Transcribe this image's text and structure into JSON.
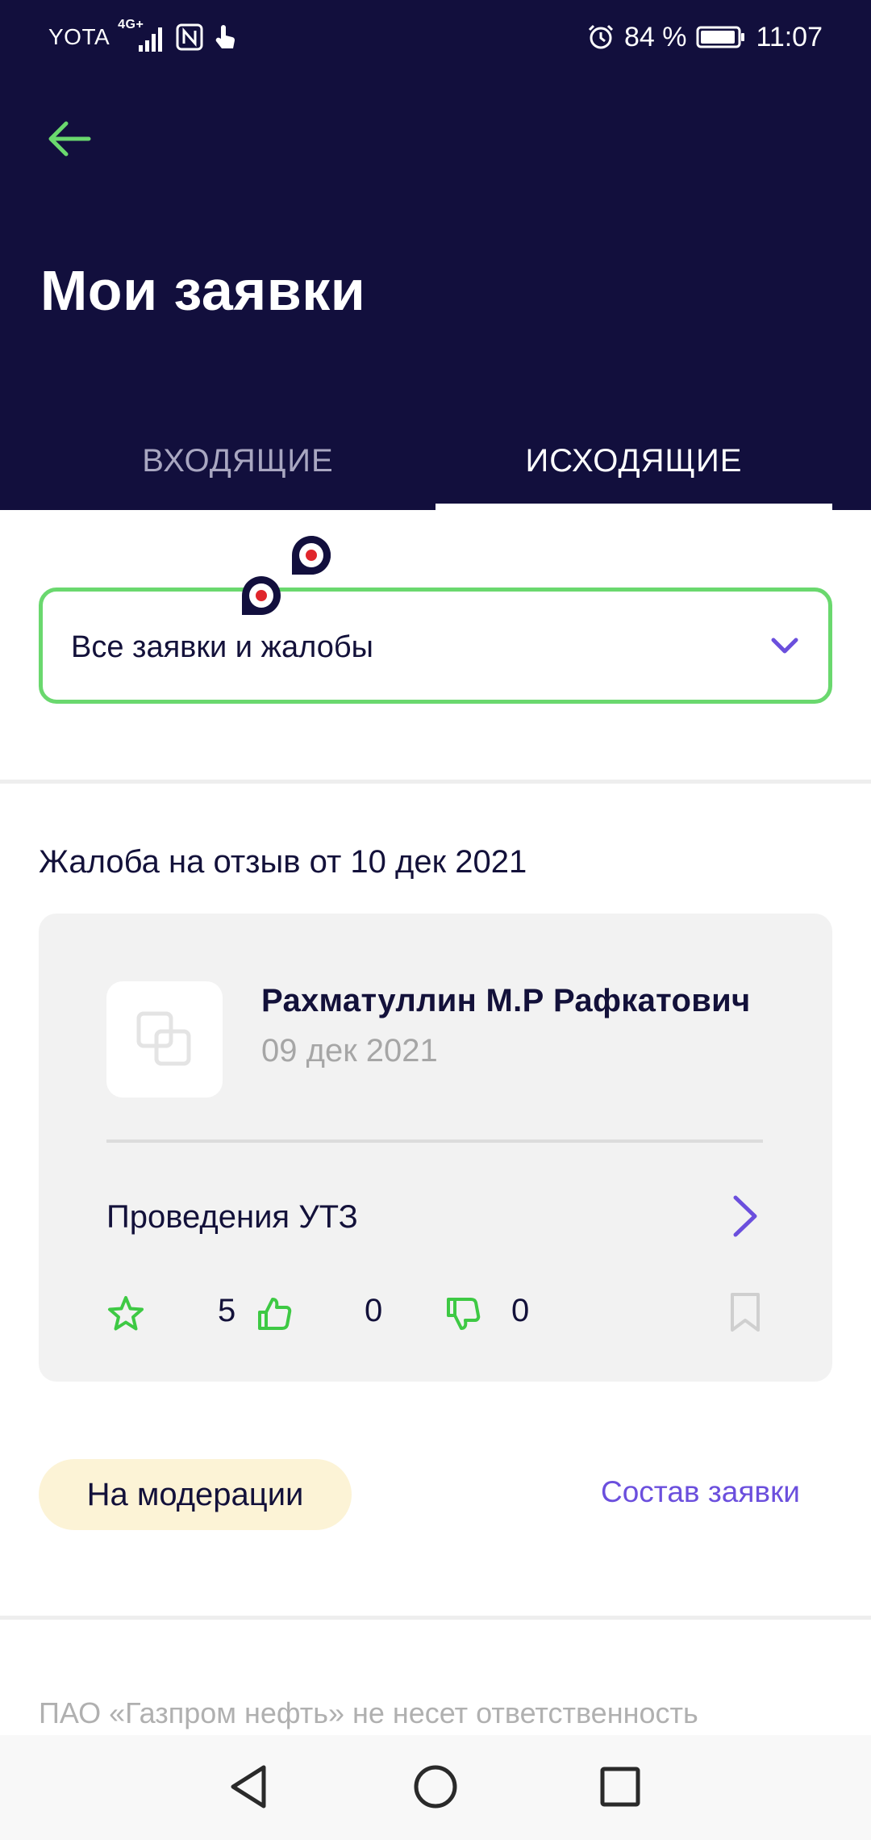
{
  "status_bar": {
    "carrier": "YOTA",
    "network": "4G+",
    "battery": "84 %",
    "time": "11:07"
  },
  "header": {
    "title": "Мои заявки"
  },
  "tabs": [
    {
      "label": "ВХОДЯЩИЕ",
      "active": false
    },
    {
      "label": "ИСХОДЯЩИЕ",
      "active": true
    }
  ],
  "filter": {
    "selected": "Все заявки и жалобы"
  },
  "complaint": {
    "section_title": "Жалоба на отзыв от 10 дек 2021",
    "author": "Рахматуллин М.Р Рафкатович",
    "date": "09 дек 2021",
    "service": "Проведения УТЗ",
    "rating": "5",
    "likes": "0",
    "dislikes": "0",
    "status": "На модерации",
    "details_link": "Состав заявки"
  },
  "disclaimer": "ПАО «Газпром нефть» не несет ответственность",
  "colors": {
    "header_bg": "#120f3d",
    "accent_green": "#6ad86e",
    "accent_purple": "#6b4fdd",
    "status_badge_bg": "#fcf3d6"
  },
  "icons": {
    "back": "arrow-left-icon",
    "chevron": "chevron-down-icon",
    "arrow": "chevron-right-icon",
    "rating": "star-icon",
    "like": "thumbs-up-icon",
    "dislike": "thumbs-down-icon",
    "bookmark": "bookmark-icon"
  }
}
